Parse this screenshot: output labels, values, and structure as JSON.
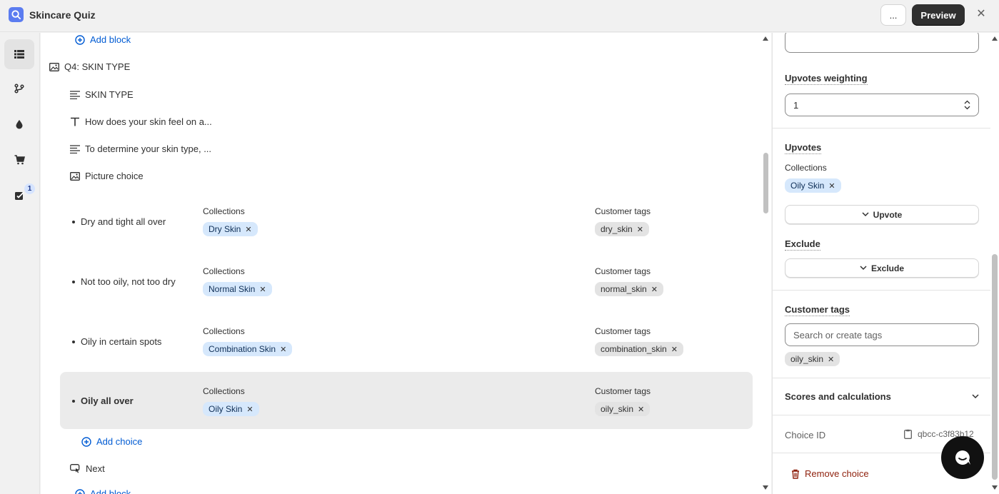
{
  "app": {
    "title": "Skincare Quiz",
    "more_label": "...",
    "preview_label": "Preview",
    "close_label": "✕"
  },
  "rail": {
    "badge": "1"
  },
  "editor": {
    "add_block_label": "Add block",
    "question_title": "Q4: SKIN TYPE",
    "blocks": [
      {
        "icon": "text-lines-icon",
        "label": "SKIN TYPE"
      },
      {
        "icon": "heading-icon",
        "label": "How does your skin feel on a..."
      },
      {
        "icon": "text-lines-icon",
        "label": "To determine your skin type, ..."
      },
      {
        "icon": "image-icon",
        "label": "Picture choice"
      }
    ],
    "collections_label": "Collections",
    "customer_tags_label": "Customer tags",
    "choices": [
      {
        "label": "Dry and tight all over",
        "collection": "Dry Skin",
        "tag": "dry_skin",
        "selected": false
      },
      {
        "label": "Not too oily, not too dry",
        "collection": "Normal Skin",
        "tag": "normal_skin",
        "selected": false
      },
      {
        "label": "Oily in certain spots",
        "collection": "Combination Skin",
        "tag": "combination_skin",
        "selected": false
      },
      {
        "label": "Oily all over",
        "collection": "Oily Skin",
        "tag": "oily_skin",
        "selected": true
      }
    ],
    "add_choice_label": "Add choice",
    "next_label": "Next",
    "add_block_bottom_label": "Add block"
  },
  "panel": {
    "upvotes_weighting_label": "Upvotes weighting",
    "upvotes_weighting_value": "1",
    "upvotes_label": "Upvotes",
    "collections_label": "Collections",
    "upvote_collection_tag": "Oily Skin",
    "upvote_button": "Upvote",
    "exclude_label": "Exclude",
    "exclude_button": "Exclude",
    "customer_tags_label": "Customer tags",
    "tags_placeholder": "Search or create tags",
    "customer_tag": "oily_skin",
    "scores_label": "Scores and calculations",
    "choice_id_label": "Choice ID",
    "choice_id_value": "qbcc-c3f83b12",
    "remove_choice_label": "Remove choice"
  },
  "colors": {
    "link": "#005bd3",
    "selected_bg": "#ebebeb",
    "collection_tag_bg": "#d6e8fc",
    "danger": "#8e1f0b",
    "primary_button": "#303030"
  }
}
